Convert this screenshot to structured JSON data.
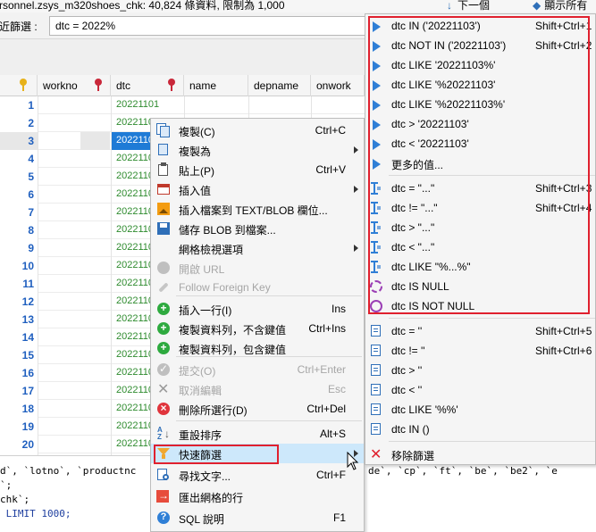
{
  "topbar": {
    "info": "rsonnel.zsys_m320shoes_chk: 40,824 條資料, 限制為 1,000",
    "next_arrow": "↓",
    "next_label": "下一個",
    "showall_arrow": "◆",
    "showall_label": "顯示所有"
  },
  "filter": {
    "label": "近篩選 :",
    "value": "dtc = 2022%"
  },
  "grid": {
    "columns": [
      "workno",
      "dtc",
      "name",
      "depname",
      "onwork"
    ],
    "rows": [
      {
        "num": "1",
        "dtc": "20221101"
      },
      {
        "num": "2",
        "dtc": "2022110"
      },
      {
        "num": "3",
        "dtc": "2022110"
      },
      {
        "num": "4",
        "dtc": "2022110"
      },
      {
        "num": "5",
        "dtc": "2022110"
      },
      {
        "num": "6",
        "dtc": "2022110"
      },
      {
        "num": "7",
        "dtc": "2022110"
      },
      {
        "num": "8",
        "dtc": "2022110"
      },
      {
        "num": "9",
        "dtc": "2022110"
      },
      {
        "num": "10",
        "dtc": "2022110"
      },
      {
        "num": "11",
        "dtc": "2022110"
      },
      {
        "num": "12",
        "dtc": "2022110"
      },
      {
        "num": "13",
        "dtc": "2022110"
      },
      {
        "num": "14",
        "dtc": "2022110"
      },
      {
        "num": "15",
        "dtc": "2022110"
      },
      {
        "num": "16",
        "dtc": "2022110"
      },
      {
        "num": "17",
        "dtc": "2022110"
      },
      {
        "num": "18",
        "dtc": "2022110"
      },
      {
        "num": "19",
        "dtc": "2022110"
      },
      {
        "num": "20",
        "dtc": "2022110"
      }
    ],
    "selected_row": 3
  },
  "sql": {
    "line1": "d`, `lotno`, `productnc",
    "line1_right": "de`, `cp`, `ft`, `be`, `be2`, `e",
    "line2": "`;",
    "line3": "chk`;",
    "line4": " LIMIT 1000;"
  },
  "context_menu": {
    "items": [
      {
        "label": "複製(C)",
        "shortcut": "Ctrl+C",
        "icon": "copy-icon"
      },
      {
        "label": "複製為",
        "shortcut": "",
        "icon": "copy-as-icon",
        "submenu": true
      },
      {
        "label": "貼上(P)",
        "shortcut": "Ctrl+V",
        "icon": "paste-icon"
      },
      {
        "label": "插入值",
        "shortcut": "",
        "icon": "calendar-icon",
        "submenu": true
      },
      {
        "label": "插入檔案到 TEXT/BLOB 欄位...",
        "shortcut": "",
        "icon": "image-file-icon"
      },
      {
        "label": "儲存 BLOB 到檔案...",
        "shortcut": "",
        "icon": "save-icon"
      },
      {
        "label": "網格檢視選項",
        "shortcut": "",
        "icon": "",
        "submenu": true
      },
      {
        "label": "開啟 URL",
        "shortcut": "",
        "icon": "globe-icon",
        "disabled": true
      },
      {
        "label": "Follow Foreign Key",
        "shortcut": "",
        "icon": "link-icon",
        "disabled": true
      },
      {
        "label": "插入一行(I)",
        "shortcut": "Ins",
        "icon": "add-row-icon"
      },
      {
        "label": "複製資料列，不含鍵值",
        "shortcut": "Ctrl+Ins",
        "icon": "duplicate-row-icon"
      },
      {
        "label": "複製資料列，包含鍵值",
        "shortcut": "",
        "icon": "duplicate-row-keys-icon"
      },
      {
        "label": "提交(O)",
        "shortcut": "Ctrl+Enter",
        "icon": "check-icon",
        "disabled": true
      },
      {
        "label": "取消編輯",
        "shortcut": "Esc",
        "icon": "cancel-icon",
        "disabled": true
      },
      {
        "label": "刪除所選行(D)",
        "shortcut": "Ctrl+Del",
        "icon": "delete-icon"
      },
      {
        "label": "重設排序",
        "shortcut": "Alt+S",
        "icon": "sort-icon"
      },
      {
        "label": "快速篩選",
        "shortcut": "",
        "icon": "funnel-icon",
        "submenu": true,
        "highlighted": true
      },
      {
        "label": "尋找文字...",
        "shortcut": "Ctrl+F",
        "icon": "search-icon"
      },
      {
        "label": "匯出網格的行",
        "shortcut": "",
        "icon": "export-icon"
      },
      {
        "label": "SQL 說明",
        "shortcut": "F1",
        "icon": "help-icon"
      }
    ]
  },
  "quick_filter": {
    "items": [
      {
        "label": "dtc IN ('20221103')",
        "shortcut": "Shift+Ctrl+1",
        "icon": "arrow-icon"
      },
      {
        "label": "dtc NOT IN ('20221103')",
        "shortcut": "Shift+Ctrl+2",
        "icon": "arrow-icon"
      },
      {
        "label": "dtc LIKE '20221103%'",
        "shortcut": "",
        "icon": "arrow-icon"
      },
      {
        "label": "dtc LIKE '%20221103'",
        "shortcut": "",
        "icon": "arrow-icon"
      },
      {
        "label": "dtc LIKE '%20221103%'",
        "shortcut": "",
        "icon": "arrow-icon"
      },
      {
        "label": "dtc > '20221103'",
        "shortcut": "",
        "icon": "arrow-icon"
      },
      {
        "label": "dtc < '20221103'",
        "shortcut": "",
        "icon": "arrow-icon"
      },
      {
        "label": "更多的值...",
        "shortcut": "",
        "icon": "arrow-icon"
      },
      {
        "label": "dtc = \"...\"",
        "shortcut": "Shift+Ctrl+3",
        "icon": "text-cursor-icon"
      },
      {
        "label": "dtc != \"...\"",
        "shortcut": "Shift+Ctrl+4",
        "icon": "text-cursor-icon"
      },
      {
        "label": "dtc > \"...\"",
        "shortcut": "",
        "icon": "text-cursor-icon"
      },
      {
        "label": "dtc < \"...\"",
        "shortcut": "",
        "icon": "text-cursor-icon"
      },
      {
        "label": "dtc LIKE \"%...%\"",
        "shortcut": "",
        "icon": "text-cursor-icon"
      },
      {
        "label": "dtc IS NULL",
        "shortcut": "",
        "icon": "null-dashed-icon"
      },
      {
        "label": "dtc IS NOT NULL",
        "shortcut": "",
        "icon": "not-null-icon"
      },
      {
        "label": "dtc = ''",
        "shortcut": "Shift+Ctrl+5",
        "icon": "document-icon"
      },
      {
        "label": "dtc != ''",
        "shortcut": "Shift+Ctrl+6",
        "icon": "document-icon"
      },
      {
        "label": "dtc > ''",
        "shortcut": "",
        "icon": "document-icon"
      },
      {
        "label": "dtc < ''",
        "shortcut": "",
        "icon": "document-icon"
      },
      {
        "label": "dtc LIKE '%%'",
        "shortcut": "",
        "icon": "document-icon"
      },
      {
        "label": "dtc IN ()",
        "shortcut": "",
        "icon": "document-icon"
      },
      {
        "label": "移除篩選",
        "shortcut": "",
        "icon": "remove-filter-icon"
      }
    ]
  },
  "colors": {
    "highlight_box": "#e0202e",
    "selected_cell": "#1f7bd6",
    "row_number": "#1f5fbf",
    "dtc_text": "#2e8b2e"
  }
}
